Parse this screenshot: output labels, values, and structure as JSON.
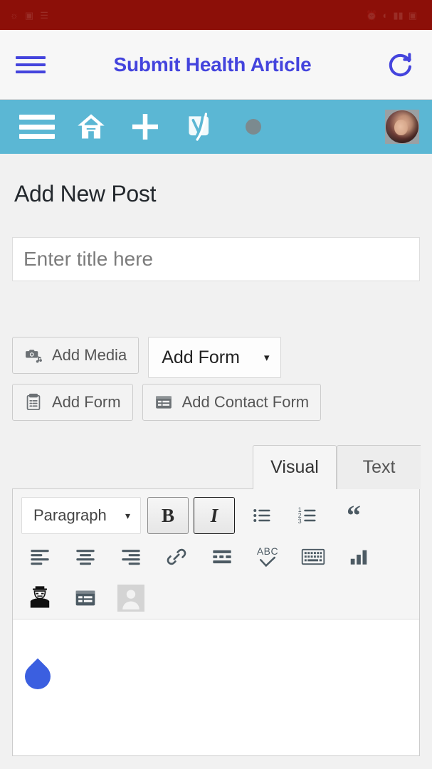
{
  "status_bar": {
    "left_icons": [
      "camera-icon",
      "photo-icon",
      "signal-icon"
    ],
    "right_icons": [
      "alarm-icon",
      "wifi-icon",
      "signal-bars-icon",
      "battery-icon"
    ],
    "time": "",
    "background": "#8c0f08"
  },
  "browser": {
    "menu_icon": "hamburger-menu-icon",
    "title": "Submit Health Article",
    "reload_icon": "reload-icon",
    "accent": "#4444dd",
    "background": "#f7f7f7"
  },
  "adminbar": {
    "background": "#5bb7d4",
    "items": [
      {
        "name": "menu-icon",
        "label": ""
      },
      {
        "name": "home-icon",
        "label": ""
      },
      {
        "name": "new-content-icon",
        "label": ""
      },
      {
        "name": "yoast-seo-icon",
        "label": ""
      },
      {
        "name": "notification-dot",
        "label": ""
      }
    ],
    "avatar": "user-avatar"
  },
  "page": {
    "heading": "Add New Post",
    "title_placeholder": "Enter title here"
  },
  "media_buttons": {
    "add_media": {
      "label": "Add Media",
      "icon": "media-icon"
    },
    "add_form_select": {
      "label": "Add Form",
      "caret": "▾"
    },
    "add_form": {
      "label": "Add Form",
      "icon": "clipboard-form-icon"
    },
    "add_contact_form": {
      "label": "Add Contact Form",
      "icon": "contact-form-icon"
    }
  },
  "editor": {
    "tabs": [
      {
        "label": "Visual",
        "active": true
      },
      {
        "label": "Text",
        "active": false
      }
    ],
    "toolbar_row1": {
      "format_select": {
        "label": "Paragraph",
        "caret": "▾"
      },
      "bold": {
        "label": "B",
        "name": "bold-button",
        "active": true
      },
      "italic": {
        "label": "I",
        "name": "italic-button",
        "active": true
      },
      "bullets": "unordered-list-icon",
      "numbers": "ordered-list-icon",
      "quote": "blockquote-icon",
      "quote_glyph": "“"
    },
    "toolbar_row2": [
      "align-left-icon",
      "align-center-icon",
      "align-right-icon",
      "insert-link-icon",
      "read-more-icon",
      "spellcheck-icon",
      "fullscreen-keyboard-icon",
      "toolbar-toggle-icon"
    ],
    "spellcheck_label": "ABC",
    "toolbar_row3": [
      "blackhat-plugin-icon",
      "contact-form-icon",
      "user-placeholder-icon"
    ],
    "content_cursor": "text-selection-handle",
    "cursor_color": "#3b5fe0"
  }
}
